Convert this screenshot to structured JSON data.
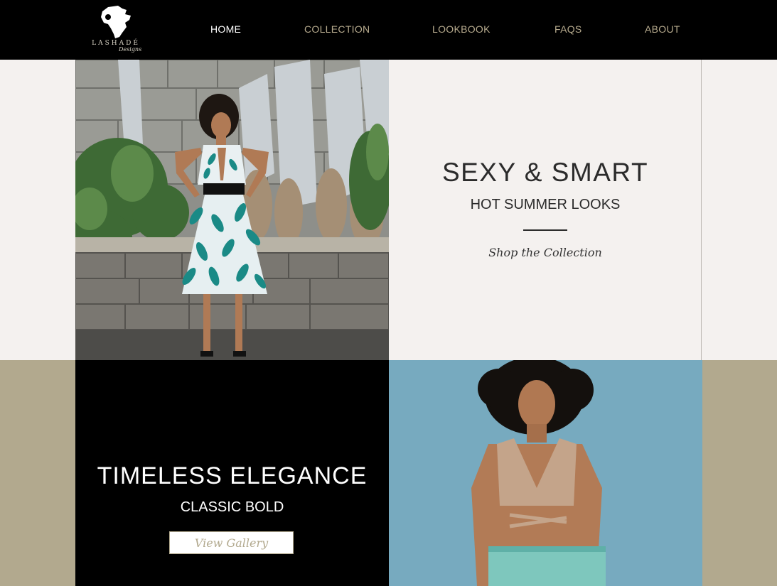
{
  "brand": {
    "name": "LASHADÉ",
    "sub": "Designs"
  },
  "nav": {
    "items": [
      {
        "label": "HOME",
        "active": true
      },
      {
        "label": "COLLECTION",
        "active": false
      },
      {
        "label": "LOOKBOOK",
        "active": false
      },
      {
        "label": "FAQS",
        "active": false
      },
      {
        "label": "ABOUT",
        "active": false
      }
    ]
  },
  "hero": {
    "title": "SEXY & SMART",
    "subtitle": "HOT SUMMER LOOKS",
    "link": "Shop the Collection"
  },
  "feature": {
    "title": "TIMELESS ELEGANCE",
    "subtitle": "CLASSIC BOLD",
    "button": "View Gallery"
  },
  "colors": {
    "header_bg": "#000000",
    "nav_text": "#b7ab8e",
    "nav_active": "#ffffff",
    "hero_bg": "#f4f1ef",
    "accent_band": "#b2a98e"
  }
}
